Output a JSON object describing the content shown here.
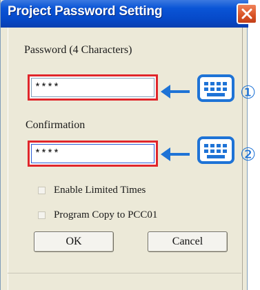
{
  "dialog": {
    "title": "Project Password Setting",
    "close_symbol": "✕"
  },
  "password": {
    "label": "Password (4 Characters)",
    "value": "****"
  },
  "confirmation": {
    "label": "Confirmation",
    "value": "****"
  },
  "options": [
    {
      "label": "Enable Limited Times",
      "checked": false
    },
    {
      "label": "Program Copy to PCC01",
      "checked": false
    }
  ],
  "buttons": {
    "ok": "OK",
    "cancel": "Cancel"
  },
  "annotations": {
    "step1": "①",
    "step2": "②",
    "icon": "keyboard-icon",
    "accent_color": "#1e73d6",
    "highlight_color": "#e0262b"
  }
}
